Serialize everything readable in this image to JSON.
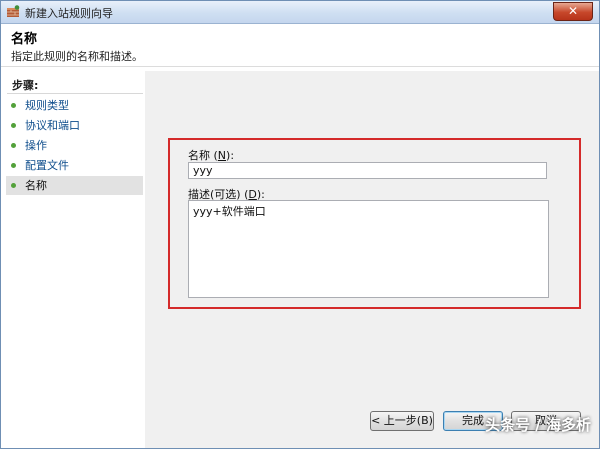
{
  "window": {
    "title": "新建入站规则向导",
    "close_label": "✕"
  },
  "header": {
    "title": "名称",
    "subtitle": "指定此规则的名称和描述。"
  },
  "sidebar": {
    "steps_title": "步骤:",
    "items": [
      {
        "label": "规则类型",
        "active": false
      },
      {
        "label": "协议和端口",
        "active": false
      },
      {
        "label": "操作",
        "active": false
      },
      {
        "label": "配置文件",
        "active": false
      },
      {
        "label": "名称",
        "active": true
      }
    ]
  },
  "form": {
    "name_label": "名称",
    "name_shortcut": "N",
    "name_value": "yyy",
    "desc_label": "描述(可选)",
    "desc_shortcut": "D",
    "desc_value": "yyy+软件端口"
  },
  "buttons": {
    "back": "< 上一步(B)",
    "finish": "完成",
    "cancel": "取消"
  },
  "watermark": "头条号 / 海多析",
  "colors": {
    "highlight_border": "#d42a2a",
    "link_text": "#0e4d8c",
    "step_dot": "#53a13a"
  }
}
